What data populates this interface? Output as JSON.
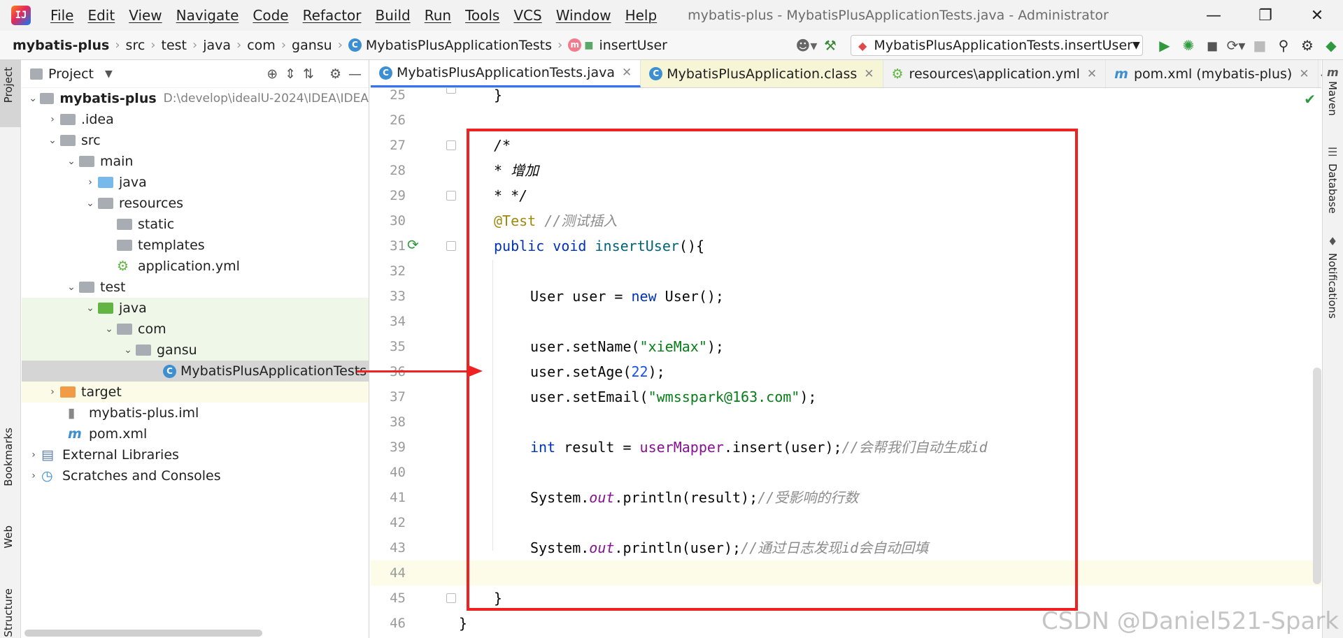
{
  "window": {
    "title": "mybatis-plus - MybatisPlusApplicationTests.java - Administrator"
  },
  "menu": [
    "File",
    "Edit",
    "View",
    "Navigate",
    "Code",
    "Refactor",
    "Build",
    "Run",
    "Tools",
    "VCS",
    "Window",
    "Help"
  ],
  "breadcrumb": [
    "mybatis-plus",
    "src",
    "test",
    "java",
    "com",
    "gansu",
    "MybatisPlusApplicationTests",
    "insertUser"
  ],
  "run_config": "MybatisPlusApplicationTests.insertUser",
  "project_panel": {
    "title": "Project"
  },
  "tree": [
    {
      "label": "mybatis-plus",
      "path": "D:\\develop\\idealU-2024\\IDEA\\IDEA"
    },
    {
      "label": ".idea"
    },
    {
      "label": "src"
    },
    {
      "label": "main"
    },
    {
      "label": "java"
    },
    {
      "label": "resources"
    },
    {
      "label": "static"
    },
    {
      "label": "templates"
    },
    {
      "label": "application.yml"
    },
    {
      "label": "test"
    },
    {
      "label": "java"
    },
    {
      "label": "com"
    },
    {
      "label": "gansu"
    },
    {
      "label": "MybatisPlusApplicationTests"
    },
    {
      "label": "target"
    },
    {
      "label": "mybatis-plus.iml"
    },
    {
      "label": "pom.xml"
    },
    {
      "label": "External Libraries"
    },
    {
      "label": "Scratches and Consoles"
    }
  ],
  "tabs": [
    {
      "label": "MybatisPlusApplicationTests.java"
    },
    {
      "label": "MybatisPlusApplication.class"
    },
    {
      "label": "resources\\application.yml"
    },
    {
      "label": "pom.xml (mybatis-plus)"
    }
  ],
  "left_tools": [
    "Project",
    "Bookmarks",
    "Web",
    "Structure"
  ],
  "right_tools": [
    "Maven",
    "Database",
    "Notifications"
  ],
  "line_numbers": [
    "25",
    "26",
    "27",
    "28",
    "29",
    "30",
    "31",
    "32",
    "33",
    "34",
    "35",
    "36",
    "37",
    "38",
    "39",
    "40",
    "41",
    "42",
    "43",
    "44",
    "45",
    "46"
  ],
  "code": {
    "l25": "}",
    "l27": "/*",
    "l28": "* 增加",
    "l29": "* */",
    "l30_ann": "@Test",
    "l30_cmt": "//测试插入",
    "l31_kw": "public void",
    "l31_fn": "insertUser",
    "l31_rest": "(){",
    "l33_a": "User user = ",
    "l33_kw": "new",
    "l33_b": " User();",
    "l35_a": "user.setName(",
    "l35_s": "\"xieMax\"",
    "l35_b": ");",
    "l36_a": "user.setAge(",
    "l36_n": "22",
    "l36_b": ");",
    "l37_a": "user.setEmail(",
    "l37_s": "\"wmsspark@163.com\"",
    "l37_b": ");",
    "l39_kw": "int",
    "l39_a": " result = ",
    "l39_f": "userMapper",
    "l39_b": ".insert(user);",
    "l39_c": "//会帮我们自动生成id",
    "l41_a": "System.",
    "l41_s": "out",
    "l41_b": ".println(result);",
    "l41_c": "//受影响的行数",
    "l43_a": "System.",
    "l43_s": "out",
    "l43_b": ".println(user);",
    "l43_c": "//通过日志发现id会自动回填",
    "l45": "}",
    "l46": "}"
  },
  "watermark": "CSDN @Daniel521-Spark"
}
